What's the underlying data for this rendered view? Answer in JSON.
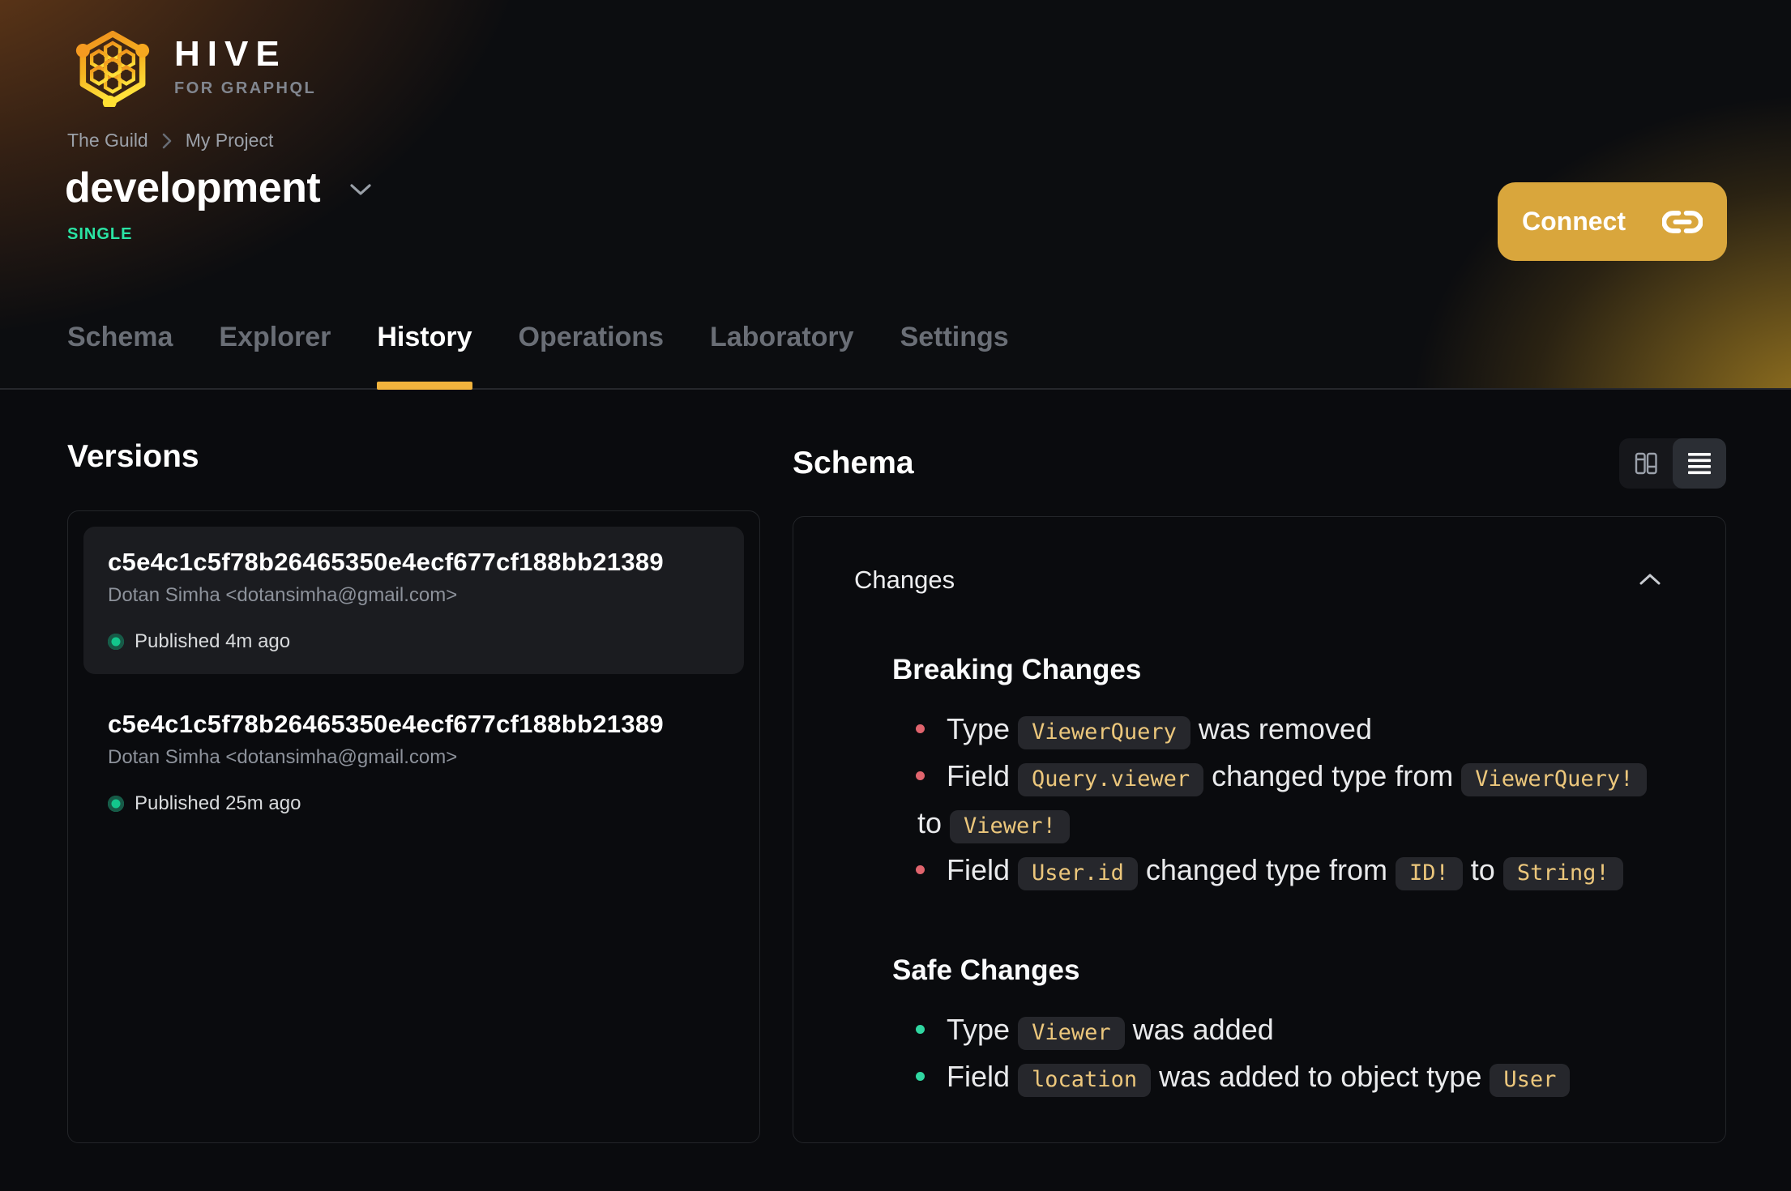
{
  "brand": {
    "name": "HIVE",
    "tagline": "FOR GRAPHQL"
  },
  "breadcrumb": {
    "org": "The Guild",
    "project": "My Project"
  },
  "target": {
    "name": "development",
    "badge": "SINGLE"
  },
  "connect": {
    "label": "Connect",
    "icon": "link-icon"
  },
  "tabs": [
    {
      "label": "Schema",
      "active": false
    },
    {
      "label": "Explorer",
      "active": false
    },
    {
      "label": "History",
      "active": true
    },
    {
      "label": "Operations",
      "active": false
    },
    {
      "label": "Laboratory",
      "active": false
    },
    {
      "label": "Settings",
      "active": false
    }
  ],
  "versions": {
    "title": "Versions",
    "items": [
      {
        "hash": "c5e4c1c5f78b26465350e4ecf677cf188bb21389",
        "author": "Dotan Simha <dotansimha@gmail.com>",
        "status": "Published 4m ago",
        "selected": true
      },
      {
        "hash": "c5e4c1c5f78b26465350e4ecf677cf188bb21389",
        "author": "Dotan Simha <dotansimha@gmail.com>",
        "status": "Published 25m ago",
        "selected": false
      }
    ]
  },
  "schema": {
    "title": "Schema",
    "view_toggle": {
      "icons": [
        "columns-icon",
        "list-icon"
      ],
      "selected": "list-icon"
    },
    "changes_label": "Changes",
    "collapse_icon": "chevron-up-icon",
    "sections": [
      {
        "title": "Breaking Changes",
        "kind": "breaking",
        "items": [
          {
            "lines": [
              [
                {
                  "t": "text",
                  "v": "Type "
                },
                {
                  "t": "code",
                  "v": "ViewerQuery"
                },
                {
                  "t": "text",
                  "v": " was removed"
                }
              ]
            ]
          },
          {
            "lines": [
              [
                {
                  "t": "text",
                  "v": "Field "
                },
                {
                  "t": "code",
                  "v": "Query.viewer"
                },
                {
                  "t": "text",
                  "v": " changed type from "
                },
                {
                  "t": "code",
                  "v": "ViewerQuery!"
                }
              ],
              [
                {
                  "t": "text",
                  "v": "to "
                },
                {
                  "t": "code",
                  "v": "Viewer!"
                }
              ]
            ]
          },
          {
            "lines": [
              [
                {
                  "t": "text",
                  "v": "Field "
                },
                {
                  "t": "code",
                  "v": "User.id"
                },
                {
                  "t": "text",
                  "v": " changed type from "
                },
                {
                  "t": "code",
                  "v": "ID!"
                },
                {
                  "t": "text",
                  "v": " to "
                },
                {
                  "t": "code",
                  "v": "String!"
                }
              ]
            ]
          }
        ]
      },
      {
        "title": "Safe Changes",
        "kind": "safe",
        "items": [
          {
            "lines": [
              [
                {
                  "t": "text",
                  "v": "Type "
                },
                {
                  "t": "code",
                  "v": "Viewer"
                },
                {
                  "t": "text",
                  "v": " was added"
                }
              ]
            ]
          },
          {
            "lines": [
              [
                {
                  "t": "text",
                  "v": "Field "
                },
                {
                  "t": "code",
                  "v": "location"
                },
                {
                  "t": "text",
                  "v": " was added to object type "
                },
                {
                  "t": "code",
                  "v": "User"
                }
              ]
            ]
          }
        ]
      }
    ]
  },
  "colors": {
    "accent_amber": "#f2b33d",
    "connect_bg": "#d9a63c",
    "badge_green": "#2ae5a5",
    "breaking_dot": "#e0646d",
    "safe_dot": "#30d7a1",
    "code_text": "#ecc77c",
    "published_dot": "#13c68c"
  }
}
